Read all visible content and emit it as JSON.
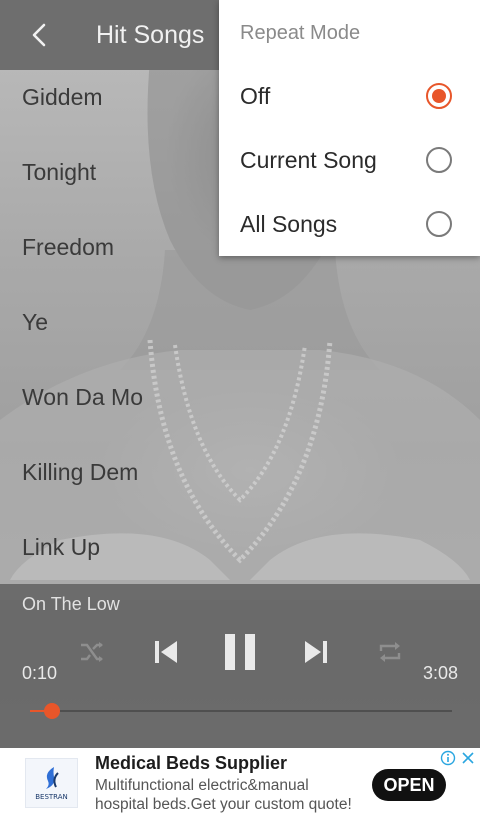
{
  "app_bar": {
    "title": "Hit Songs",
    "back_icon": "chevron-left-icon"
  },
  "songs": [
    {
      "title": "Giddem"
    },
    {
      "title": "Tonight"
    },
    {
      "title": "Freedom"
    },
    {
      "title": "Ye"
    },
    {
      "title": "Won Da Mo"
    },
    {
      "title": "Killing Dem"
    },
    {
      "title": "Link Up"
    }
  ],
  "player": {
    "now_playing": "On The Low",
    "elapsed": "0:10",
    "duration": "3:08",
    "progress": 0.053,
    "state": "playing",
    "icons": [
      "shuffle-icon",
      "previous-icon",
      "pause-icon",
      "next-icon",
      "repeat-icon"
    ]
  },
  "repeat_menu": {
    "title": "Repeat Mode",
    "options": [
      {
        "label": "Off",
        "selected": true
      },
      {
        "label": "Current Song",
        "selected": false
      },
      {
        "label": "All Songs",
        "selected": false
      }
    ]
  },
  "ad": {
    "title": "Medical Beds Supplier",
    "description": "Multifunctional electric&manual hospital beds.Get your custom quote!",
    "cta": "OPEN",
    "logo_text": "BESTRAN"
  },
  "colors": {
    "accent": "#e8562a",
    "app_bar": "#6e6e6e",
    "player_panel": "#5a5a5a"
  }
}
